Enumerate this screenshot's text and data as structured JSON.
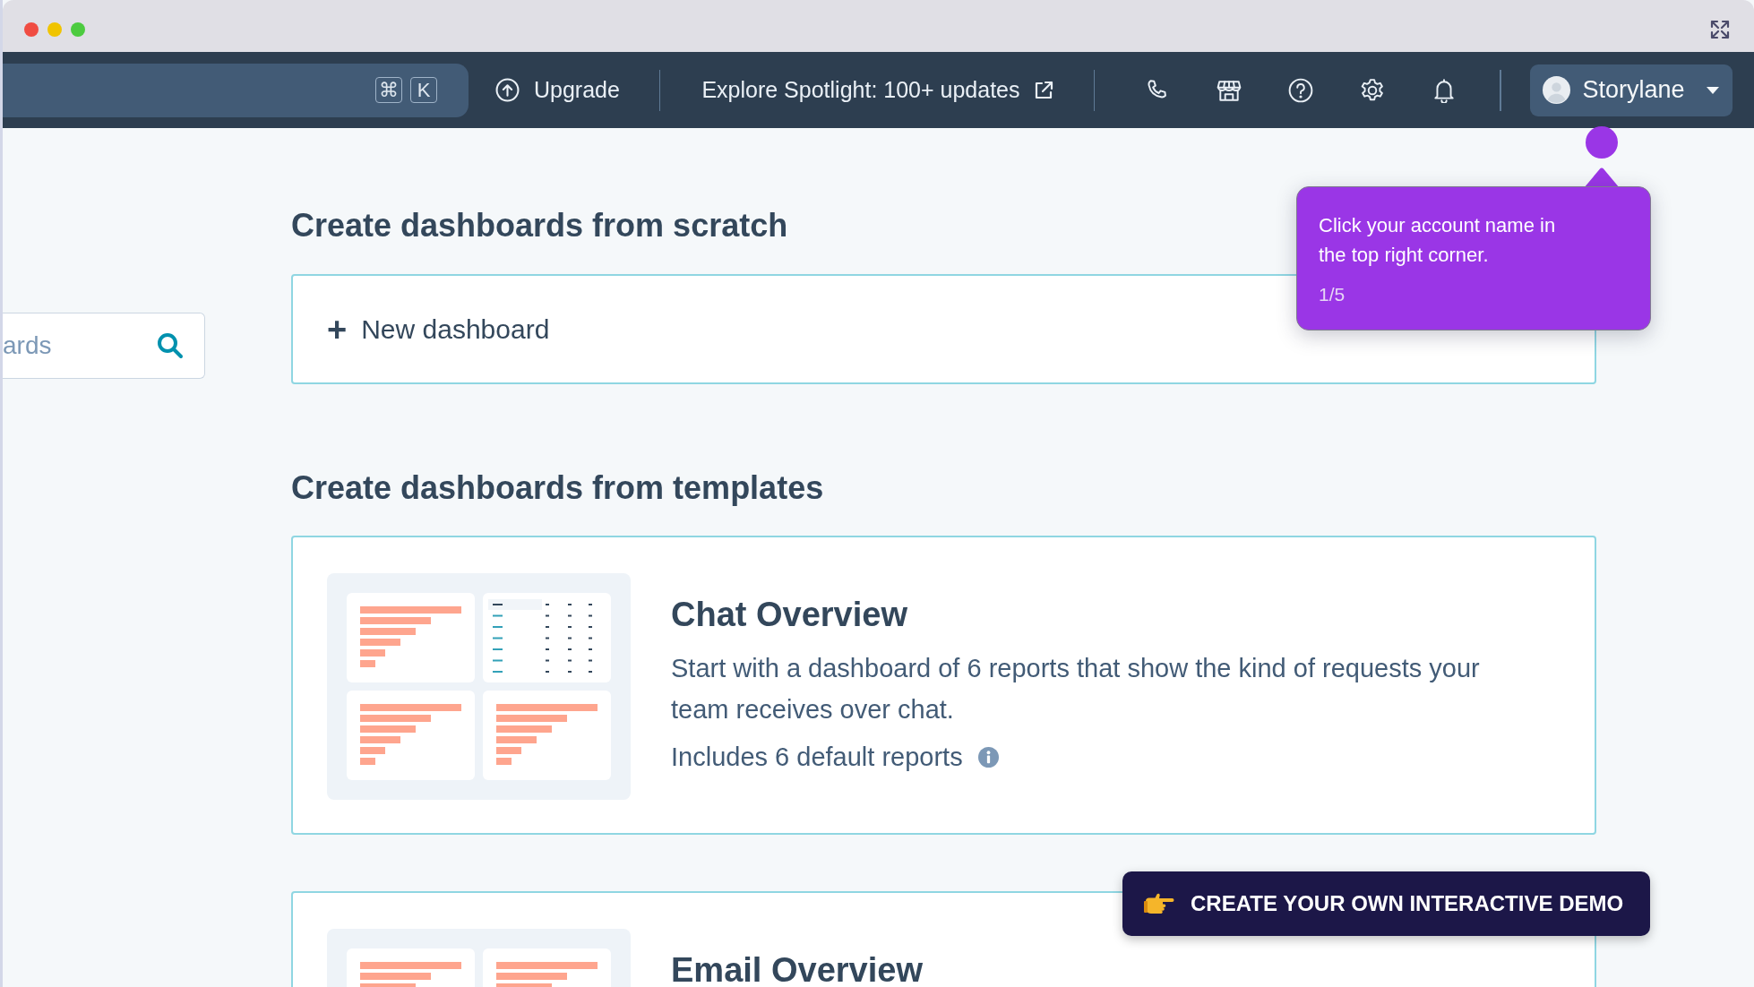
{
  "window": {
    "traffic_lights": [
      {
        "color": "#f04c42"
      },
      {
        "color": "#f0c400"
      },
      {
        "color": "#4ccb3f"
      }
    ]
  },
  "top_nav": {
    "shortcut_keys": [
      "⌘",
      "K"
    ],
    "upgrade": "Upgrade",
    "spotlight": "Explore Spotlight: 100+ updates",
    "account": "Storylane"
  },
  "sidebar": {
    "search": {
      "placeholder": "ards"
    }
  },
  "scratch": {
    "heading": "Create dashboards from scratch",
    "new_button": {
      "icon": "+",
      "label": "New dashboard"
    }
  },
  "templates": {
    "heading": "Create dashboards from templates",
    "items": [
      {
        "title": "Chat Overview",
        "description": "Start with a dashboard of 6 reports that show the kind of requests your team receives over chat.",
        "includes": "Includes 6 default reports"
      },
      {
        "title": "Email Overview"
      }
    ]
  },
  "tour_tooltip": {
    "text": "Click your account name in the top right corner.",
    "step": "1/5"
  },
  "cta": {
    "label": "CREATE YOUR OWN INTERACTIVE DEMO"
  }
}
